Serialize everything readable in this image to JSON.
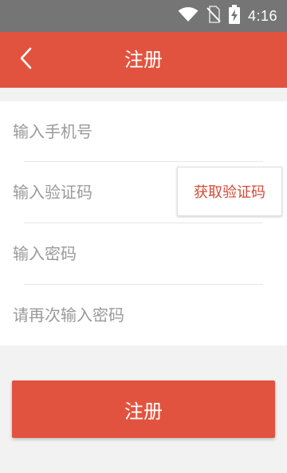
{
  "status_bar": {
    "time": "4:16",
    "icons": [
      "wifi-icon",
      "no-sim-icon",
      "battery-charging-icon"
    ]
  },
  "header": {
    "back_icon": "chevron-left-icon",
    "title": "注册"
  },
  "form": {
    "phone": {
      "value": "",
      "placeholder": "输入手机号"
    },
    "code": {
      "value": "",
      "placeholder": "输入验证码"
    },
    "get_code_label": "获取验证码",
    "password": {
      "value": "",
      "placeholder": "输入密码"
    },
    "confirm_password": {
      "value": "",
      "placeholder": "请再次输入密码"
    }
  },
  "register_label": "注册",
  "colors": {
    "accent": "#e2533f",
    "status_bar": "#757575",
    "background": "#f2f2f2"
  }
}
